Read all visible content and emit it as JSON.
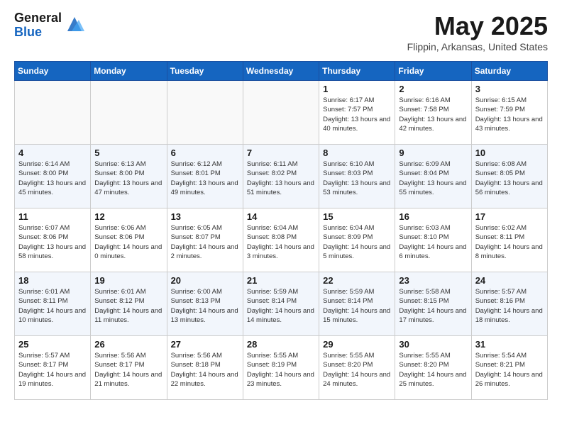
{
  "header": {
    "logo_general": "General",
    "logo_blue": "Blue",
    "month_title": "May 2025",
    "location": "Flippin, Arkansas, United States"
  },
  "weekdays": [
    "Sunday",
    "Monday",
    "Tuesday",
    "Wednesday",
    "Thursday",
    "Friday",
    "Saturday"
  ],
  "weeks": [
    [
      {
        "day": "",
        "empty": true
      },
      {
        "day": "",
        "empty": true
      },
      {
        "day": "",
        "empty": true
      },
      {
        "day": "",
        "empty": true
      },
      {
        "day": "1",
        "sunrise": "6:17 AM",
        "sunset": "7:57 PM",
        "daylight": "13 hours and 40 minutes."
      },
      {
        "day": "2",
        "sunrise": "6:16 AM",
        "sunset": "7:58 PM",
        "daylight": "13 hours and 42 minutes."
      },
      {
        "day": "3",
        "sunrise": "6:15 AM",
        "sunset": "7:59 PM",
        "daylight": "13 hours and 43 minutes."
      }
    ],
    [
      {
        "day": "4",
        "sunrise": "6:14 AM",
        "sunset": "8:00 PM",
        "daylight": "13 hours and 45 minutes."
      },
      {
        "day": "5",
        "sunrise": "6:13 AM",
        "sunset": "8:00 PM",
        "daylight": "13 hours and 47 minutes."
      },
      {
        "day": "6",
        "sunrise": "6:12 AM",
        "sunset": "8:01 PM",
        "daylight": "13 hours and 49 minutes."
      },
      {
        "day": "7",
        "sunrise": "6:11 AM",
        "sunset": "8:02 PM",
        "daylight": "13 hours and 51 minutes."
      },
      {
        "day": "8",
        "sunrise": "6:10 AM",
        "sunset": "8:03 PM",
        "daylight": "13 hours and 53 minutes."
      },
      {
        "day": "9",
        "sunrise": "6:09 AM",
        "sunset": "8:04 PM",
        "daylight": "13 hours and 55 minutes."
      },
      {
        "day": "10",
        "sunrise": "6:08 AM",
        "sunset": "8:05 PM",
        "daylight": "13 hours and 56 minutes."
      }
    ],
    [
      {
        "day": "11",
        "sunrise": "6:07 AM",
        "sunset": "8:06 PM",
        "daylight": "13 hours and 58 minutes."
      },
      {
        "day": "12",
        "sunrise": "6:06 AM",
        "sunset": "8:06 PM",
        "daylight": "14 hours and 0 minutes."
      },
      {
        "day": "13",
        "sunrise": "6:05 AM",
        "sunset": "8:07 PM",
        "daylight": "14 hours and 2 minutes."
      },
      {
        "day": "14",
        "sunrise": "6:04 AM",
        "sunset": "8:08 PM",
        "daylight": "14 hours and 3 minutes."
      },
      {
        "day": "15",
        "sunrise": "6:04 AM",
        "sunset": "8:09 PM",
        "daylight": "14 hours and 5 minutes."
      },
      {
        "day": "16",
        "sunrise": "6:03 AM",
        "sunset": "8:10 PM",
        "daylight": "14 hours and 6 minutes."
      },
      {
        "day": "17",
        "sunrise": "6:02 AM",
        "sunset": "8:11 PM",
        "daylight": "14 hours and 8 minutes."
      }
    ],
    [
      {
        "day": "18",
        "sunrise": "6:01 AM",
        "sunset": "8:11 PM",
        "daylight": "14 hours and 10 minutes."
      },
      {
        "day": "19",
        "sunrise": "6:01 AM",
        "sunset": "8:12 PM",
        "daylight": "14 hours and 11 minutes."
      },
      {
        "day": "20",
        "sunrise": "6:00 AM",
        "sunset": "8:13 PM",
        "daylight": "14 hours and 13 minutes."
      },
      {
        "day": "21",
        "sunrise": "5:59 AM",
        "sunset": "8:14 PM",
        "daylight": "14 hours and 14 minutes."
      },
      {
        "day": "22",
        "sunrise": "5:59 AM",
        "sunset": "8:14 PM",
        "daylight": "14 hours and 15 minutes."
      },
      {
        "day": "23",
        "sunrise": "5:58 AM",
        "sunset": "8:15 PM",
        "daylight": "14 hours and 17 minutes."
      },
      {
        "day": "24",
        "sunrise": "5:57 AM",
        "sunset": "8:16 PM",
        "daylight": "14 hours and 18 minutes."
      }
    ],
    [
      {
        "day": "25",
        "sunrise": "5:57 AM",
        "sunset": "8:17 PM",
        "daylight": "14 hours and 19 minutes."
      },
      {
        "day": "26",
        "sunrise": "5:56 AM",
        "sunset": "8:17 PM",
        "daylight": "14 hours and 21 minutes."
      },
      {
        "day": "27",
        "sunrise": "5:56 AM",
        "sunset": "8:18 PM",
        "daylight": "14 hours and 22 minutes."
      },
      {
        "day": "28",
        "sunrise": "5:55 AM",
        "sunset": "8:19 PM",
        "daylight": "14 hours and 23 minutes."
      },
      {
        "day": "29",
        "sunrise": "5:55 AM",
        "sunset": "8:20 PM",
        "daylight": "14 hours and 24 minutes."
      },
      {
        "day": "30",
        "sunrise": "5:55 AM",
        "sunset": "8:20 PM",
        "daylight": "14 hours and 25 minutes."
      },
      {
        "day": "31",
        "sunrise": "5:54 AM",
        "sunset": "8:21 PM",
        "daylight": "14 hours and 26 minutes."
      }
    ]
  ]
}
